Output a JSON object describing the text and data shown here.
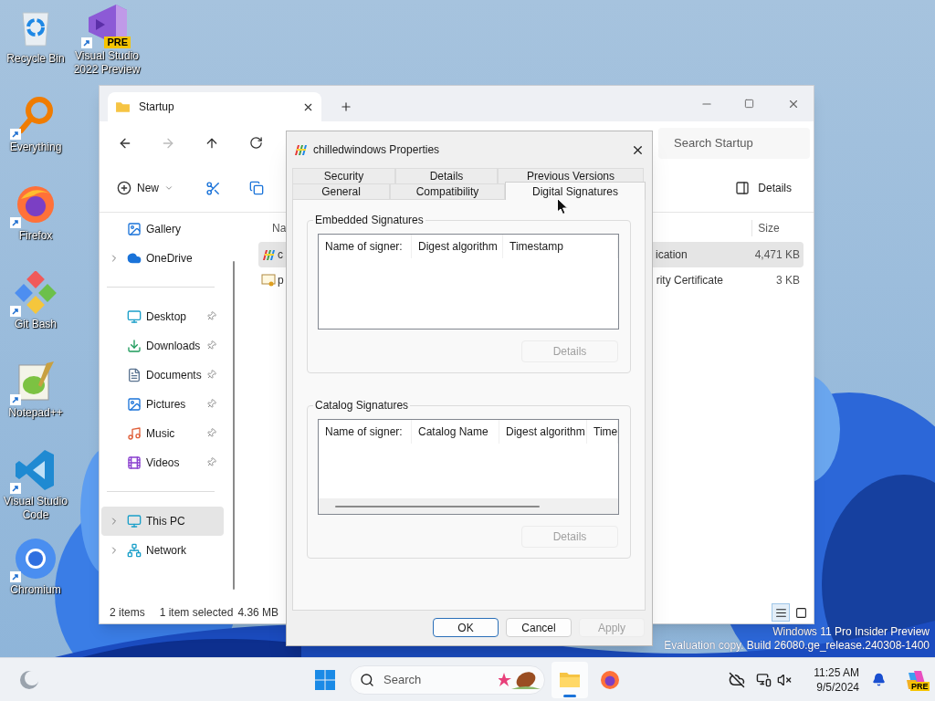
{
  "desktop": {
    "columns": [
      [
        {
          "kind": "recycle-bin",
          "label": "Recycle Bin",
          "shortcut": false
        },
        {
          "kind": "everything",
          "label": "Everything",
          "shortcut": true
        },
        {
          "kind": "firefox",
          "label": "Firefox",
          "shortcut": true
        },
        {
          "kind": "git-bash",
          "label": "Git Bash",
          "shortcut": true
        },
        {
          "kind": "notepad",
          "label": "Notepad++",
          "shortcut": true
        },
        {
          "kind": "vscode",
          "label": "Visual Studio Code",
          "shortcut": true
        },
        {
          "kind": "chromium",
          "label": "Chromium",
          "shortcut": true
        }
      ],
      [
        {
          "kind": "visual-studio",
          "label": "Visual Studio 2022 Preview",
          "shortcut": true,
          "badge": "PRE"
        }
      ]
    ],
    "watermark": [
      "Windows 11 Pro Insider Preview",
      "Evaluation copy. Build 26080.ge_release.240308-1400"
    ]
  },
  "explorer": {
    "tab": "Startup",
    "search": {
      "placeholder": "Search Startup"
    },
    "toolbar": {
      "new": "New",
      "details": "Details"
    },
    "sidebar": [
      [
        {
          "kind": "gallery",
          "label": "Gallery",
          "expandable": false,
          "pinned": false,
          "selected": false
        },
        {
          "kind": "onedrive",
          "label": "OneDrive",
          "expandable": true,
          "pinned": false,
          "selected": false
        }
      ],
      [
        {
          "kind": "desktop",
          "label": "Desktop",
          "expandable": false,
          "pinned": true,
          "selected": false
        },
        {
          "kind": "downloads",
          "label": "Downloads",
          "expandable": false,
          "pinned": true,
          "selected": false
        },
        {
          "kind": "documents",
          "label": "Documents",
          "expandable": false,
          "pinned": true,
          "selected": false
        },
        {
          "kind": "pictures",
          "label": "Pictures",
          "expandable": false,
          "pinned": true,
          "selected": false
        },
        {
          "kind": "music",
          "label": "Music",
          "expandable": false,
          "pinned": true,
          "selected": false
        },
        {
          "kind": "videos",
          "label": "Videos",
          "expandable": false,
          "pinned": true,
          "selected": false
        }
      ],
      [
        {
          "kind": "this-pc",
          "label": "This PC",
          "expandable": true,
          "pinned": false,
          "selected": true
        },
        {
          "kind": "network",
          "label": "Network",
          "expandable": true,
          "pinned": false,
          "selected": false
        }
      ]
    ],
    "columns": [
      "Na",
      "Size"
    ],
    "rows": [
      {
        "kind": "app",
        "name": "c",
        "type": "ication",
        "size": "4,471 KB",
        "selected": true
      },
      {
        "kind": "certificate",
        "name": "p",
        "type": "rity Certificate",
        "size": "3 KB",
        "selected": false
      }
    ],
    "status": {
      "count": "2 items",
      "selection": "1 item selected",
      "size": "4.36 MB"
    },
    "views": [
      {
        "kind": "details",
        "selected": true
      },
      {
        "kind": "tiles",
        "selected": false
      }
    ]
  },
  "dialog": {
    "title": "chilledwindows Properties",
    "tab_rows": [
      [
        {
          "label": "Security",
          "selected": false
        },
        {
          "label": "Details",
          "selected": false
        },
        {
          "label": "Previous Versions",
          "selected": false
        }
      ],
      [
        {
          "label": "General",
          "selected": false
        },
        {
          "label": "Compatibility",
          "selected": false
        },
        {
          "label": "Digital Signatures",
          "selected": true
        }
      ]
    ],
    "groups": [
      {
        "title": "Embedded Signatures",
        "columns": [
          "Name of signer:",
          "Digest algorithm",
          "Timestamp"
        ],
        "scrollbar": false,
        "button": {
          "label": "Details",
          "disabled": true
        }
      },
      {
        "title": "Catalog Signatures",
        "columns": [
          "Name of signer:",
          "Catalog Name",
          "Digest algorithm",
          "Time"
        ],
        "scrollbar": true,
        "button": {
          "label": "Details",
          "disabled": true
        }
      }
    ],
    "buttons": [
      {
        "label": "OK",
        "default": true,
        "disabled": false
      },
      {
        "label": "Cancel",
        "default": false,
        "disabled": false
      },
      {
        "label": "Apply",
        "default": false,
        "disabled": true
      }
    ]
  },
  "taskbar": {
    "search": {
      "placeholder": "Search"
    },
    "apps": [
      {
        "kind": "file-explorer",
        "active": true
      },
      {
        "kind": "firefox",
        "active": false
      }
    ],
    "clock": {
      "time": "11:25 AM",
      "date": "9/5/2024"
    },
    "copilot_badge": "PRE"
  }
}
